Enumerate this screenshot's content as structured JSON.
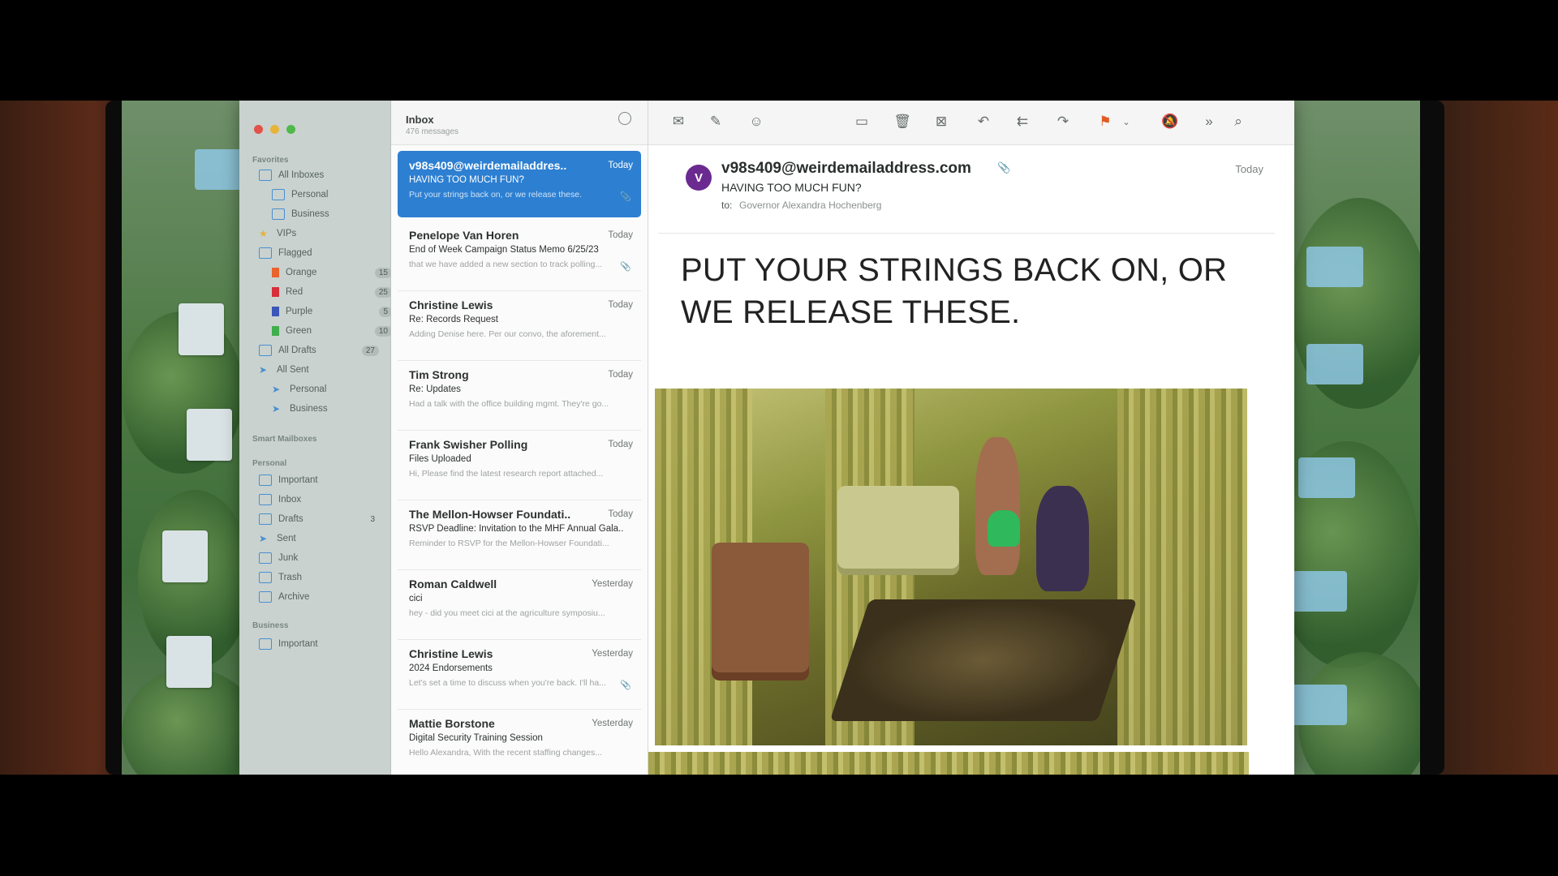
{
  "window": {
    "traffic_lights": [
      "red",
      "yellow",
      "green"
    ]
  },
  "sidebar": {
    "favorites_label": "Favorites",
    "favorites": [
      {
        "label": "All Inboxes",
        "icon": "inbox-icon"
      },
      {
        "label": "Personal",
        "icon": "inbox-icon"
      },
      {
        "label": "Business",
        "icon": "inbox-icon"
      },
      {
        "label": "VIPs",
        "icon": "star-icon"
      },
      {
        "label": "Flagged",
        "icon": "flag-icon"
      },
      {
        "label": "Orange",
        "icon": "flag-icon",
        "count": "15",
        "color": "#e9642d"
      },
      {
        "label": "Red",
        "icon": "flag-icon",
        "count": "25",
        "color": "#d6303a"
      },
      {
        "label": "Purple",
        "icon": "flag-icon",
        "count": "5",
        "color": "#3a56b8"
      },
      {
        "label": "Green",
        "icon": "flag-icon",
        "count": "10",
        "color": "#3fae4c"
      },
      {
        "label": "All Drafts",
        "icon": "document-icon",
        "count": "27"
      },
      {
        "label": "All Sent",
        "icon": "send-icon"
      },
      {
        "label": "Personal",
        "icon": "send-icon"
      },
      {
        "label": "Business",
        "icon": "send-icon"
      }
    ],
    "smart_mailboxes_label": "Smart Mailboxes",
    "personal_label": "Personal",
    "personal": [
      {
        "label": "Important",
        "icon": "folder-icon"
      },
      {
        "label": "Inbox",
        "icon": "inbox-icon"
      },
      {
        "label": "Drafts",
        "icon": "document-icon",
        "count": "3"
      },
      {
        "label": "Sent",
        "icon": "send-icon"
      },
      {
        "label": "Junk",
        "icon": "junk-icon"
      },
      {
        "label": "Trash",
        "icon": "trash-icon"
      },
      {
        "label": "Archive",
        "icon": "archive-icon"
      }
    ],
    "business_label": "Business",
    "business": [
      {
        "label": "Important",
        "icon": "folder-icon"
      }
    ]
  },
  "list": {
    "title": "Inbox",
    "subtitle": "476 messages",
    "messages": [
      {
        "from": "v98s409@weirdemailaddres..",
        "date": "Today",
        "subject": "HAVING TOO MUCH FUN?",
        "preview": "Put your strings back on, or we release these.",
        "attachment": true
      },
      {
        "from": "Penelope Van Horen",
        "date": "Today",
        "subject": "End of Week Campaign Status Memo 6/25/23",
        "preview": "that we have added a new section to track polling...",
        "attachment": true
      },
      {
        "from": "Christine Lewis",
        "date": "Today",
        "subject": "Re: Records Request",
        "preview": "Adding Denise here. Per our convo, the aforement..."
      },
      {
        "from": "Tim Strong",
        "date": "Today",
        "subject": "Re: Updates",
        "preview": "Had a talk with the office building mgmt. They're go..."
      },
      {
        "from": "Frank Swisher Polling",
        "date": "Today",
        "subject": "Files Uploaded",
        "preview": "Hi, Please find the latest research report attached..."
      },
      {
        "from": "The Mellon-Howser Foundati..",
        "date": "Today",
        "subject": "RSVP Deadline: Invitation to the MHF Annual Gala..",
        "preview": "Reminder to RSVP for the Mellon-Howser Foundati..."
      },
      {
        "from": "Roman Caldwell",
        "date": "Yesterday",
        "subject": "cici",
        "preview": "hey - did you meet cici at the agriculture symposiu..."
      },
      {
        "from": "Christine Lewis",
        "date": "Yesterday",
        "subject": "2024 Endorsements",
        "preview": "Let's set a time to discuss when you're back. I'll ha...",
        "attachment": true
      },
      {
        "from": "Mattie Borstone",
        "date": "Yesterday",
        "subject": "Digital Security Training Session",
        "preview": "Hello Alexandra, With the recent staffing changes..."
      }
    ]
  },
  "toolbar": {
    "buttons": [
      "envelope-icon",
      "compose-icon",
      "add-contact-icon",
      "archive-icon",
      "trash-icon",
      "junk-icon",
      "reply-icon",
      "reply-all-icon",
      "forward-icon",
      "flag-icon",
      "chevron-down-icon",
      "mute-icon",
      "more-icon",
      "search-icon"
    ],
    "flag_color": "#e05a24"
  },
  "viewer": {
    "avatar_letter": "V",
    "avatar_color": "#6b2a8f",
    "from": "v98s409@weirdemailaddress.com",
    "subject": "HAVING TOO MUCH FUN?",
    "to_label": "to:",
    "to": "Governor Alexandra Hochenberg",
    "date": "Today",
    "headline": "PUT YOUR STRINGS BACK ON, OR WE RELEASE THESE."
  }
}
